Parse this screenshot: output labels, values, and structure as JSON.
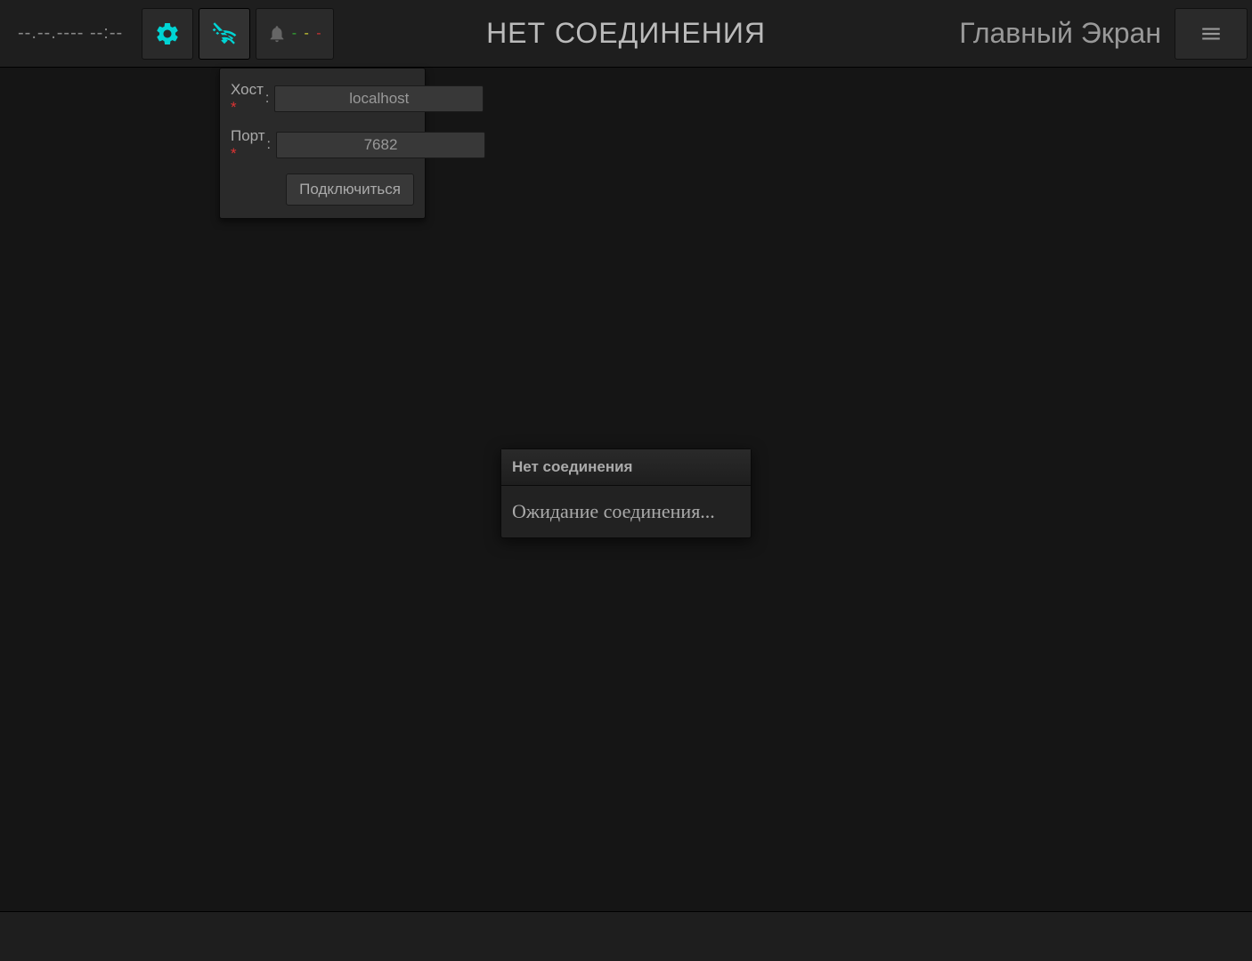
{
  "topbar": {
    "datetime": "--.--.----  --:--",
    "title": "НЕТ СОЕДИНЕНИЯ",
    "screen_label": "Главный Экран",
    "notif_dash1": "-",
    "notif_dash2": "-",
    "notif_dash3": "-"
  },
  "dropdown": {
    "host_label": "Хост",
    "port_label": "Порт",
    "host_value": "localhost",
    "port_value": "7682",
    "connect_label": "Подключиться",
    "required_mark": "*",
    "colon": ":"
  },
  "modal": {
    "header": "Нет соединения",
    "body": "Ожидание соединения..."
  }
}
